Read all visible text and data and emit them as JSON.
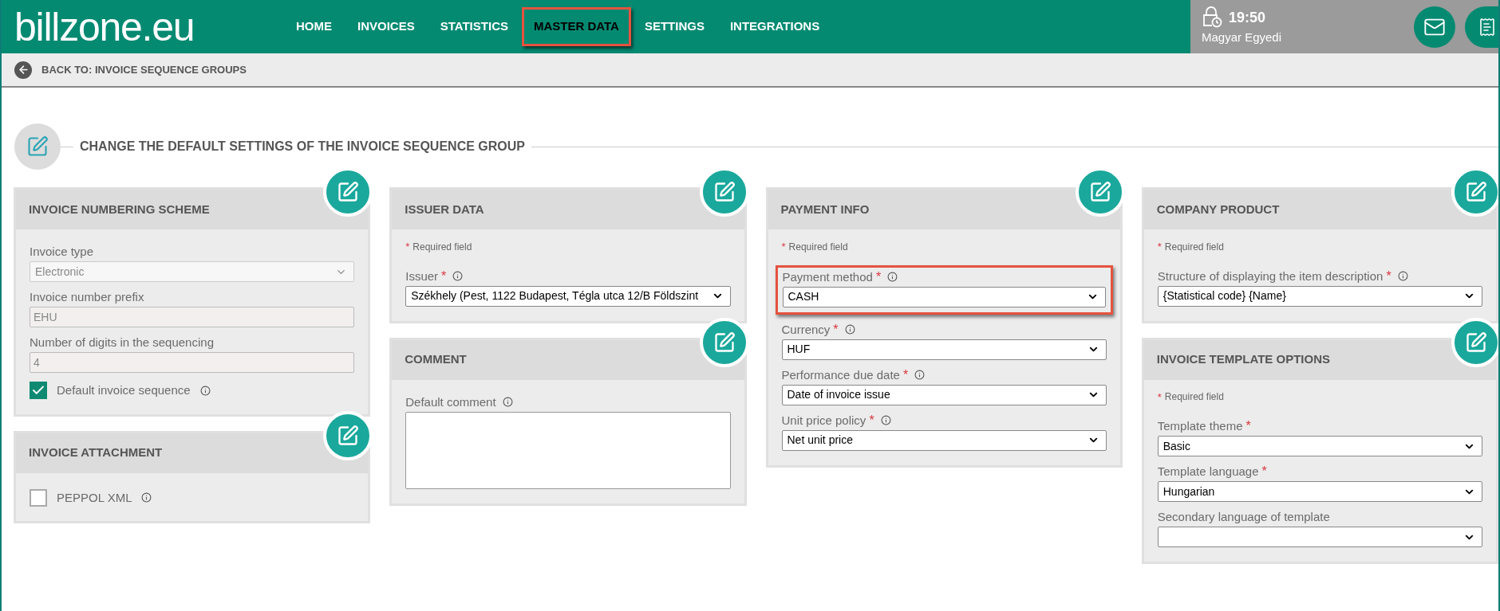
{
  "header": {
    "logo": "billzone.eu",
    "nav": [
      {
        "label": "HOME",
        "selected": false,
        "highlighted": false
      },
      {
        "label": "INVOICES",
        "selected": false,
        "highlighted": false
      },
      {
        "label": "STATISTICS",
        "selected": false,
        "highlighted": false
      },
      {
        "label": "MASTER DATA",
        "selected": true,
        "highlighted": true
      },
      {
        "label": "SETTINGS",
        "selected": false,
        "highlighted": false
      },
      {
        "label": "INTEGRATIONS",
        "selected": false,
        "highlighted": false
      }
    ],
    "session": {
      "time": "19:50",
      "user": "Magyar Egyedi"
    }
  },
  "back_link": "BACK TO: INVOICE SEQUENCE GROUPS",
  "page_title": "CHANGE THE DEFAULT SETTINGS OF THE INVOICE SEQUENCE GROUP",
  "columns": [
    {
      "cards": [
        {
          "title": "INVOICE NUMBERING SCHEME",
          "fields": [
            {
              "kind": "select",
              "label": "Invoice type",
              "value": "Electronic",
              "disabled": true,
              "info": false,
              "highlighted": false
            },
            {
              "kind": "input",
              "label": "Invoice number prefix",
              "value": "EHU",
              "disabled": true,
              "info": false,
              "highlighted": false
            },
            {
              "kind": "input",
              "label": "Number of digits in the sequencing",
              "value": "4",
              "disabled": true,
              "info": false,
              "highlighted": false
            },
            {
              "kind": "checkbox",
              "label": "Default invoice sequence",
              "checked": true,
              "info": true
            }
          ]
        },
        {
          "title": "INVOICE ATTACHMENT",
          "fields": [
            {
              "kind": "checkbox",
              "label": "PEPPOL XML",
              "checked": false,
              "info": true
            }
          ]
        }
      ]
    },
    {
      "cards": [
        {
          "title": "ISSUER DATA",
          "required_note": {
            "mark": "*",
            "text": "Required field"
          },
          "fields": [
            {
              "kind": "select",
              "label": "Issuer",
              "asterisk": "*",
              "value": "Székhely (Pest, 1122 Budapest, Tégla utca 12/B Földszint",
              "disabled": false,
              "info": true,
              "highlighted": false
            }
          ]
        },
        {
          "title": "COMMENT",
          "fields": [
            {
              "kind": "textarea",
              "label": "Default comment",
              "info": true,
              "highlighted": false
            }
          ]
        }
      ]
    },
    {
      "cards": [
        {
          "title": "PAYMENT INFO",
          "required_note": {
            "mark": "*",
            "text": "Required field"
          },
          "fields": [
            {
              "kind": "select",
              "label": "Payment method",
              "asterisk": "*",
              "value": "CASH",
              "disabled": false,
              "info": true,
              "highlighted": true
            },
            {
              "kind": "select",
              "label": "Currency",
              "asterisk": "*",
              "value": "HUF",
              "disabled": false,
              "info": true,
              "highlighted": false
            },
            {
              "kind": "select",
              "label": "Performance due date",
              "asterisk": "*",
              "value": "Date of invoice issue",
              "disabled": false,
              "info": true,
              "highlighted": false
            },
            {
              "kind": "select",
              "label": "Unit price policy",
              "asterisk": "*",
              "value": "Net unit price",
              "disabled": false,
              "info": true,
              "highlighted": false
            }
          ]
        }
      ]
    },
    {
      "cards": [
        {
          "title": "COMPANY PRODUCT",
          "required_note": {
            "mark": "*",
            "text": "Required field"
          },
          "fields": [
            {
              "kind": "select",
              "label": "Structure of displaying the item description",
              "asterisk": "*",
              "value": "{Statistical code} {Name}",
              "disabled": false,
              "info": true,
              "highlighted": false
            }
          ]
        },
        {
          "title": "INVOICE TEMPLATE OPTIONS",
          "required_note": {
            "mark": "*",
            "text": "Required field"
          },
          "fields": [
            {
              "kind": "select",
              "label": "Template theme",
              "asterisk": "*",
              "value": "Basic",
              "disabled": false,
              "info": false,
              "highlighted": false
            },
            {
              "kind": "select",
              "label": "Template language",
              "asterisk": "*",
              "value": "Hungarian",
              "disabled": false,
              "info": false,
              "highlighted": false
            },
            {
              "kind": "select",
              "label": "Secondary language of template",
              "disabled": false,
              "info": false,
              "highlighted": false
            }
          ]
        }
      ]
    }
  ]
}
